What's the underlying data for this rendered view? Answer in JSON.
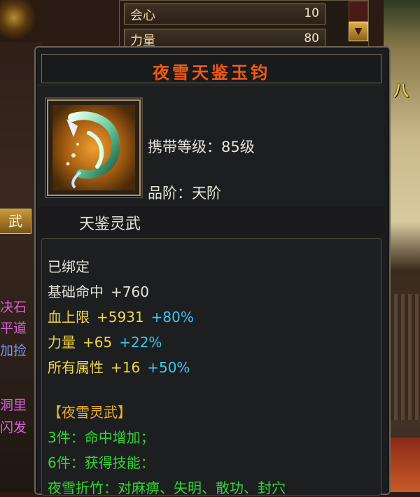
{
  "stats_panel": {
    "rows": [
      {
        "label": "会心",
        "value": "10"
      },
      {
        "label": "力量",
        "value": "80"
      }
    ]
  },
  "background": {
    "left_tab_label": "武",
    "left_texts": [
      {
        "text": "决石",
        "color": "#d860d8"
      },
      {
        "text": "平道",
        "color": "#d860d8"
      },
      {
        "text": "加捡",
        "color": "#7a9af0"
      },
      {
        "text": "洞里",
        "color": "#d860d8"
      },
      {
        "text": "闪发",
        "color": "#d860d8"
      }
    ],
    "right_banner_text": "八"
  },
  "tooltip": {
    "item_name": "夜雪天鉴玉钧",
    "item_name_color": "#f05a14",
    "icon": "jade-hook-weapon-icon",
    "required_level": "携带等级：85级",
    "grade": "品阶：天阶",
    "category": "天鉴灵武",
    "bind_status": "已绑定",
    "attributes": [
      {
        "name": "基础命中",
        "value": "+760",
        "bonus": ""
      },
      {
        "name": "血上限",
        "value": "+5931",
        "bonus": "+80%"
      },
      {
        "name": "力量",
        "value": "+65",
        "bonus": "+22%"
      },
      {
        "name": "所有属性",
        "value": "+16",
        "bonus": "+50%"
      }
    ],
    "set_bonus": {
      "title": "【夜雪灵武】",
      "entries": [
        "3件：命中增加；",
        "6件：获得技能：",
        "夜雪折竹：对麻痹、失明、散功、封穴"
      ]
    },
    "colors": {
      "primary_attr": "#f2d640",
      "bonus": "#40c8f0",
      "set_title": "#f0b020",
      "set_entries": "#30d830"
    }
  }
}
